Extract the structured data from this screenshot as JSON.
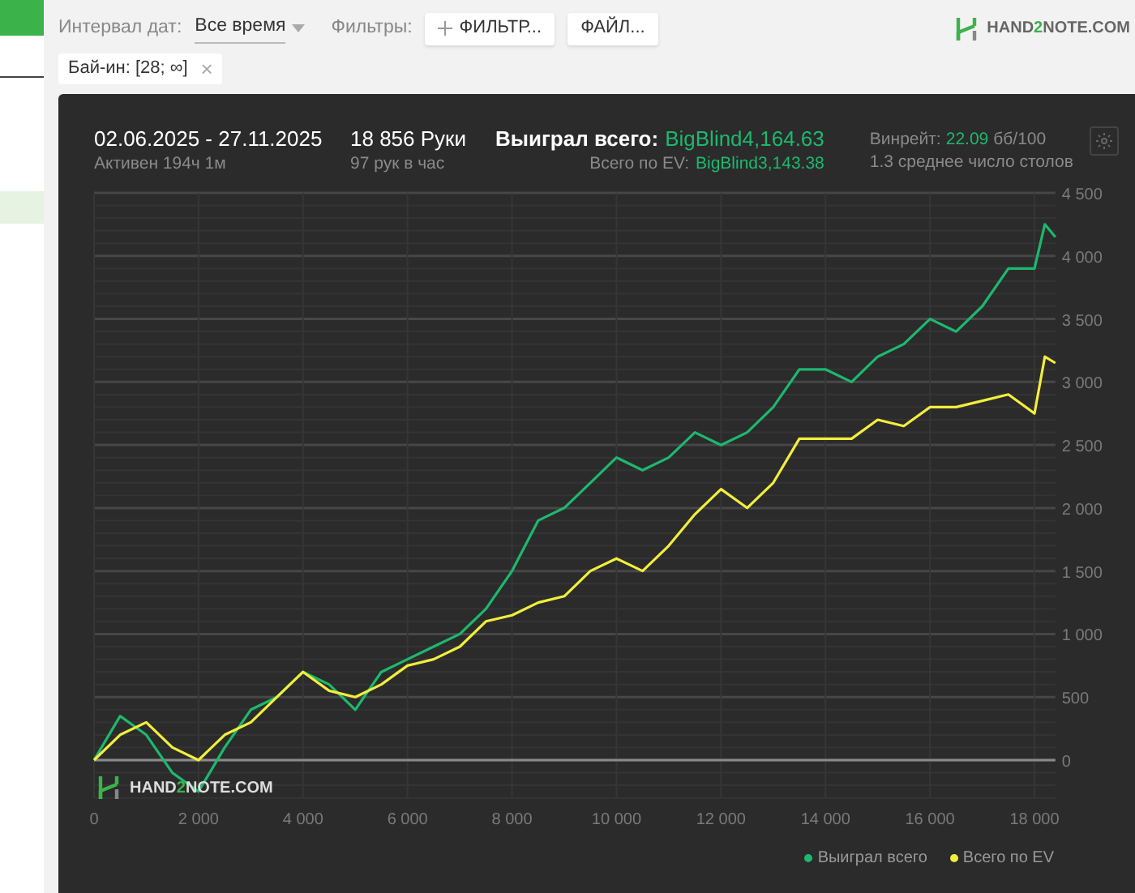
{
  "toolbar": {
    "date_label": "Интервал дат:",
    "date_value": "Все время",
    "filters_label": "Фильтры:",
    "buttons": [
      "ФИЛЬТР...",
      "ФАЙЛ..."
    ]
  },
  "logo": {
    "parts": [
      "HAND",
      "2",
      "NOTE.COM"
    ]
  },
  "chips": [
    {
      "label": "Бай-ин: [28; ∞]",
      "close": "×"
    }
  ],
  "summary": {
    "period": "02.06.2025 - 27.11.2025",
    "active": "Активен 194ч 1м",
    "hands": "18 856 Руки",
    "hands_rate": "97 рук в час",
    "won_label": "Выиграл всего:",
    "won_value": "BigBlind4,164.63",
    "ev_label": "Всего по EV:",
    "ev_value": "BigBlind3,143.38",
    "winrate_label": "Винрейт:",
    "winrate_value": "22.09",
    "winrate_unit": "бб/100",
    "tables": "1.3 среднее число столов"
  },
  "chart_data": {
    "type": "line",
    "x": [
      0,
      500,
      1000,
      1500,
      2000,
      2500,
      3000,
      3500,
      4000,
      4500,
      5000,
      5500,
      6000,
      6500,
      7000,
      7500,
      8000,
      8500,
      9000,
      9500,
      10000,
      10500,
      11000,
      11500,
      12000,
      12500,
      13000,
      13500,
      14000,
      14500,
      15000,
      15500,
      16000,
      16500,
      17000,
      17500,
      18000,
      18200,
      18400
    ],
    "series": [
      {
        "name": "Выиграл всего",
        "color": "#1db86e",
        "values": [
          0,
          350,
          200,
          -100,
          -250,
          100,
          400,
          500,
          700,
          600,
          400,
          700,
          800,
          900,
          1000,
          1200,
          1500,
          1900,
          2000,
          2200,
          2400,
          2300,
          2400,
          2600,
          2500,
          2600,
          2800,
          3100,
          3100,
          3000,
          3200,
          3300,
          3500,
          3400,
          3600,
          3900,
          3900,
          4250,
          4150
        ]
      },
      {
        "name": "Всего по EV",
        "color": "#f2ee3c",
        "values": [
          0,
          200,
          300,
          100,
          0,
          200,
          300,
          500,
          700,
          550,
          500,
          600,
          750,
          800,
          900,
          1100,
          1150,
          1250,
          1300,
          1500,
          1600,
          1500,
          1700,
          1950,
          2150,
          2000,
          2200,
          2550,
          2550,
          2550,
          2700,
          2650,
          2800,
          2800,
          2850,
          2900,
          2750,
          3200,
          3150
        ]
      }
    ],
    "xticks": [
      {
        "value": 0,
        "label": "0"
      },
      {
        "value": 2000,
        "label": "2 000"
      },
      {
        "value": 4000,
        "label": "4 000"
      },
      {
        "value": 6000,
        "label": "6 000"
      },
      {
        "value": 8000,
        "label": "8 000"
      },
      {
        "value": 10000,
        "label": "10 000"
      },
      {
        "value": 12000,
        "label": "12 000"
      },
      {
        "value": 14000,
        "label": "14 000"
      },
      {
        "value": 16000,
        "label": "16 000"
      },
      {
        "value": 18000,
        "label": "18 000"
      }
    ],
    "yticks": [
      {
        "value": 0,
        "label": "0"
      },
      {
        "value": 500,
        "label": "500"
      },
      {
        "value": 1000,
        "label": "1 000"
      },
      {
        "value": 1500,
        "label": "1 500"
      },
      {
        "value": 2000,
        "label": "2 000"
      },
      {
        "value": 2500,
        "label": "2 500"
      },
      {
        "value": 3000,
        "label": "3 000"
      },
      {
        "value": 3500,
        "label": "3 500"
      },
      {
        "value": 4000,
        "label": "4 000"
      },
      {
        "value": 4500,
        "label": "4 500"
      }
    ],
    "xlim": [
      0,
      18400
    ],
    "ylim": [
      -300,
      4500
    ],
    "grid": true
  },
  "watermark": {
    "parts": [
      "HAND",
      "2",
      "NOTE.COM"
    ]
  }
}
